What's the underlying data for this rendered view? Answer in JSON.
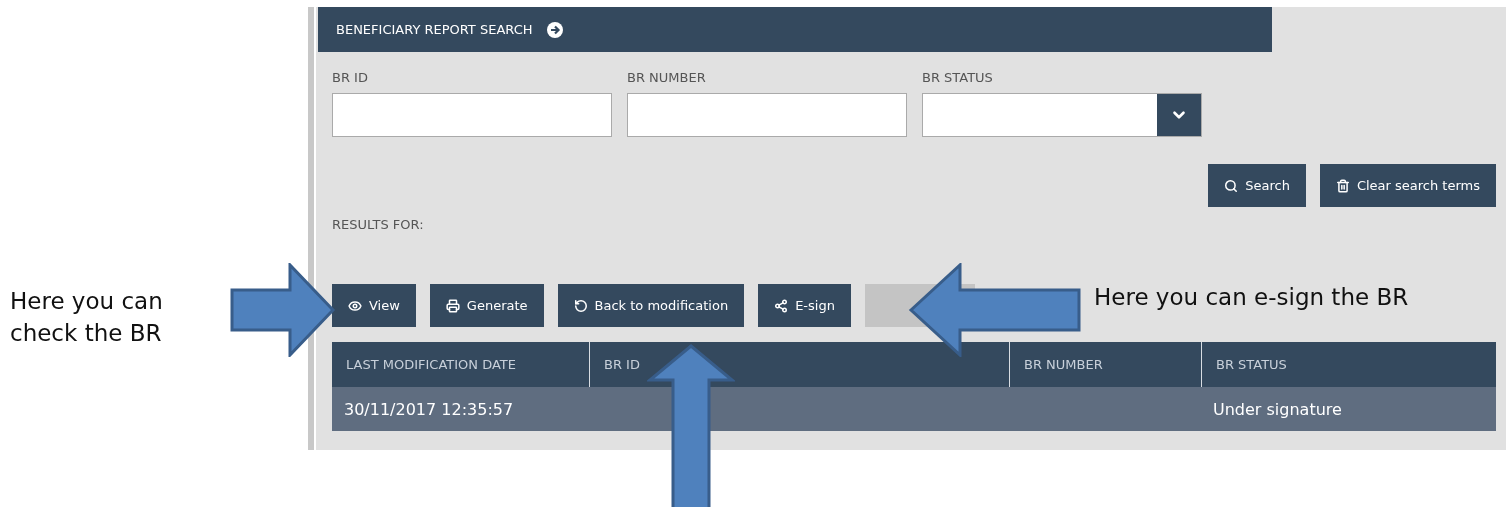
{
  "header": {
    "title": "BENEFICIARY REPORT SEARCH"
  },
  "fields": [
    {
      "label": "BR ID",
      "kind": "text"
    },
    {
      "label": "BR NUMBER",
      "kind": "text"
    },
    {
      "label": "BR STATUS",
      "kind": "select"
    }
  ],
  "search_buttons": [
    {
      "label": "Search",
      "kind": "search"
    },
    {
      "label": "Clear search terms",
      "kind": "trash"
    }
  ],
  "results_label": "RESULTS FOR:",
  "action_buttons": [
    {
      "label": "View",
      "kind": "eye"
    },
    {
      "label": "Generate",
      "kind": "print"
    },
    {
      "label": "Back to modification",
      "kind": "undo"
    },
    {
      "label": "E-sign",
      "kind": "share"
    },
    {
      "kind": "blank"
    }
  ],
  "table": {
    "columns": [
      "LAST MODIFICATION DATE",
      "BR ID",
      "BR NUMBER",
      "BR STATUS"
    ],
    "rows": [
      {
        "cells": [
          "30/11/2017 12:35:57",
          null,
          null,
          "Under signature"
        ]
      }
    ]
  },
  "annotations": [
    {
      "text": "Here you can check the BR",
      "kind": "left"
    },
    {
      "text": "Here you can e-sign the BR",
      "kind": "right"
    }
  ]
}
